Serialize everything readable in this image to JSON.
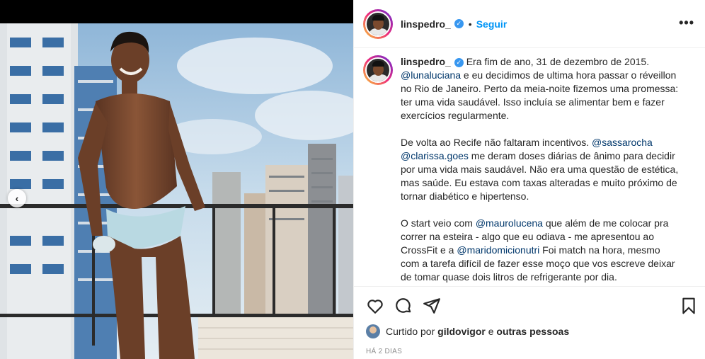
{
  "post": {
    "username": "linspedro_",
    "verified_icon": "verified-badge-icon",
    "separator": "•",
    "follow_label": "Seguir",
    "more_icon": "ellipsis-icon",
    "more_label": "•••"
  },
  "caption": {
    "username": "linspedro_",
    "p1": [
      {
        "t": "Era fim de ano, 31 de dezembro de 2015. ",
        "m": false
      },
      {
        "t": "@lunaluciana",
        "m": true
      },
      {
        "t": " e eu decidimos de ultima hora passar o réveillon no Rio de Janeiro. Perto da meia-noite fizemos uma promessa: ter uma vida saudável. Isso incluía se alimentar bem e fazer exercícios regularmente.",
        "m": false
      }
    ],
    "p2": [
      {
        "t": "De volta ao Recife não faltaram incentivos. ",
        "m": false
      },
      {
        "t": "@sassarocha",
        "m": true
      },
      {
        "t": " ",
        "m": false
      },
      {
        "t": "@clarissa.goes",
        "m": true
      },
      {
        "t": " me deram doses diárias de ânimo para decidir por uma vida mais saudável. Não era uma questão de estética, mas saúde. Eu estava com taxas alteradas e muito próximo de tornar diabético e hipertenso.",
        "m": false
      }
    ],
    "p3": [
      {
        "t": "O start veio com ",
        "m": false
      },
      {
        "t": "@maurolucena",
        "m": true
      },
      {
        "t": " que além de me colocar pra correr na esteira - algo que eu odiava - me apresentou ao CrossFit e a ",
        "m": false
      },
      {
        "t": "@maridomicionutri",
        "m": true
      },
      {
        "t": " Foi match na hora, mesmo com a tarefa difícil de fazer esse moço que vos escreve deixar de tomar quase dois litros de refrigerante por dia.",
        "m": false
      }
    ]
  },
  "actions": {
    "like_icon": "heart-icon",
    "comment_icon": "comment-icon",
    "share_icon": "send-icon",
    "save_icon": "bookmark-icon"
  },
  "likes": {
    "prefix": "Curtido por",
    "user": "gildovigor",
    "middle": "e",
    "others": "outras pessoas"
  },
  "timestamp": "HÁ 2 DIAS",
  "carousel": {
    "prev_icon": "chevron-left-icon",
    "prev_label": "‹"
  },
  "colors": {
    "accent": "#0095f6",
    "mention": "#00376b",
    "text": "#262626",
    "muted": "#8e8e8e"
  }
}
